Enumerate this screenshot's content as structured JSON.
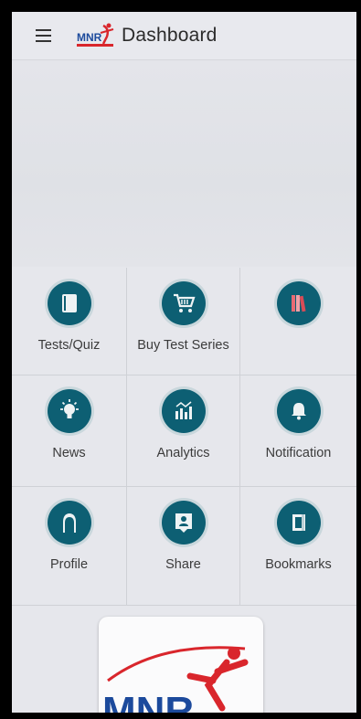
{
  "appbar": {
    "title": "Dashboard",
    "logo_text": "MNR",
    "menu_icon": "hamburger-menu-icon"
  },
  "grid": {
    "items": [
      {
        "label": "Tests/Quiz",
        "icon": "book-icon"
      },
      {
        "label": "Buy Test Series",
        "icon": "shopping-cart-icon"
      },
      {
        "label": "",
        "icon": "library-books-icon"
      },
      {
        "label": "News",
        "icon": "lightbulb-icon"
      },
      {
        "label": "Analytics",
        "icon": "bar-chart-icon"
      },
      {
        "label": "Notification",
        "icon": "bell-icon"
      },
      {
        "label": "Profile",
        "icon": "user-silhouette-icon"
      },
      {
        "label": "Share",
        "icon": "share-profile-icon"
      },
      {
        "label": "Bookmarks",
        "icon": "bookmark-icon"
      }
    ]
  },
  "promo": {
    "logo_text": "MNR"
  },
  "colors": {
    "icon_circle": "#0d5f73",
    "logo_red": "#d9262c",
    "logo_blue": "#1c4a9c"
  }
}
